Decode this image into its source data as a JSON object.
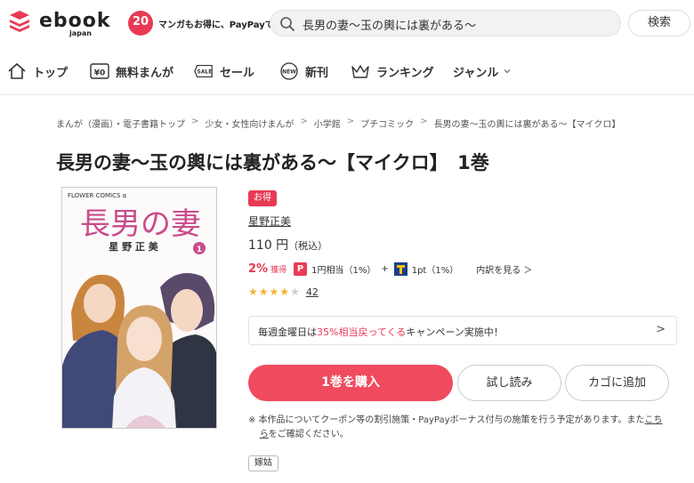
{
  "header": {
    "logo_text": "ebook",
    "logo_sub": "japan",
    "logo_badge": "20",
    "tagline": "マンガもお得に、PayPayで",
    "search_value": "長男の妻〜玉の輿には裏がある〜",
    "search_button": "検索"
  },
  "nav": {
    "items": [
      {
        "label": "トップ",
        "icon": "home-icon"
      },
      {
        "label": "無料まんが",
        "icon": "free-yen-icon"
      },
      {
        "label": "セール",
        "icon": "sale-tag-icon"
      },
      {
        "label": "新刊",
        "icon": "new-badge-icon"
      },
      {
        "label": "ランキング",
        "icon": "crown-icon"
      },
      {
        "label": "ジャンル",
        "icon": "chevron-down-icon"
      }
    ]
  },
  "breadcrumb": [
    "まんが（漫画）・電子書籍トップ",
    "少女・女性向けまんが",
    "小学館",
    "プチコミック",
    "長男の妻〜玉の輿には裏がある〜【マイクロ】"
  ],
  "breadcrumb_sep": ">",
  "product": {
    "title": "長男の妻〜玉の輿には裏がある〜【マイクロ】　1巻",
    "deal_badge": "お得",
    "author": "星野正美",
    "price": "110 円",
    "price_tax": "（税込）",
    "points": {
      "percent": "2%",
      "percent_label": "獲得",
      "paypay_text": "1円相当（1%）",
      "plus": "+",
      "tpoint_text": "1pt（1%）",
      "breakdown": "内訳を見る ＞"
    },
    "rating": 3.5,
    "review_count": "42",
    "campaign": {
      "before": "毎週金曜日は",
      "highlight": "35%相当戻ってくる",
      "after": "キャンペーン実施中！"
    },
    "buy_button": "1巻を購入",
    "sample_button": "試し読み",
    "cart_button": "カゴに追加",
    "notice": "※ 本作品についてクーポン等の割引施策・PayPayボーナス付与の施策を行う予定があります。また",
    "notice_link": "こち",
    "notice_line2_link": "ら",
    "notice_line2": "をご確認ください。",
    "tag": "嫁姑",
    "cover": {
      "imprint": "FLOWER COMICS α",
      "title": "長男の妻",
      "author": "星 野 正 美",
      "volume": "1"
    }
  },
  "colors": {
    "accent": "#e83a54",
    "buy_button": "#f04a5e",
    "star": "#f3b234"
  }
}
